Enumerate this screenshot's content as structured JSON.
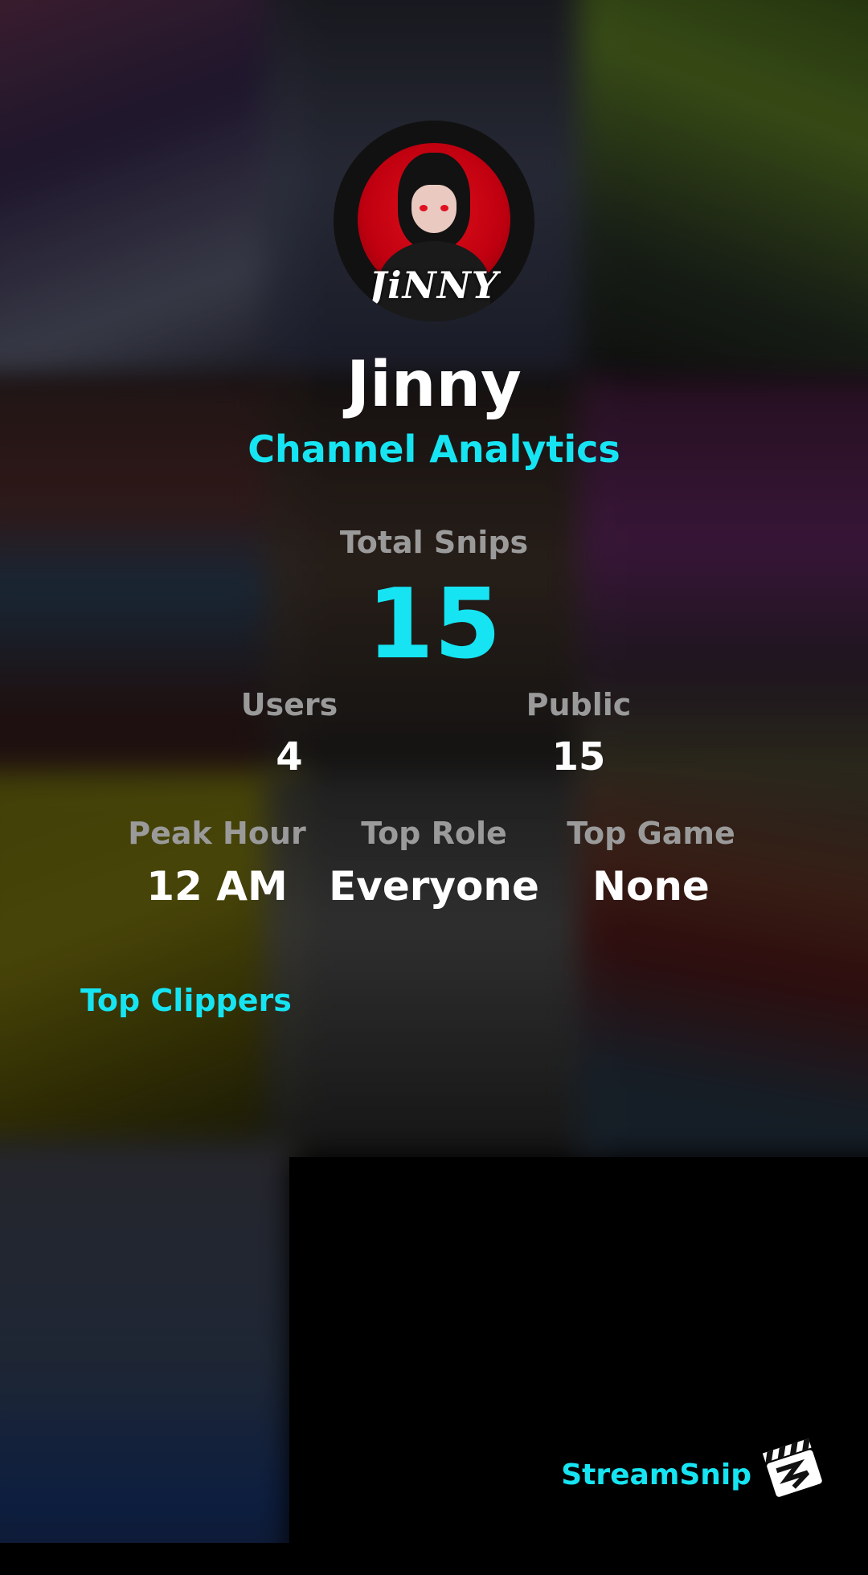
{
  "profile": {
    "avatar_text": "JiNNY",
    "name": "Jinny",
    "subtitle": "Channel Analytics"
  },
  "stats": {
    "total_snips_label": "Total Snips",
    "total_snips_value": "15",
    "users_label": "Users",
    "users_value": "4",
    "public_label": "Public",
    "public_value": "15",
    "peak_hour_label": "Peak Hour",
    "peak_hour_value": "12 AM",
    "top_role_label": "Top Role",
    "top_role_value": "Everyone",
    "top_game_label": "Top Game",
    "top_game_value": "None"
  },
  "sections": {
    "top_clippers_label": "Top Clippers"
  },
  "branding": {
    "name": "StreamSnip",
    "logo_icon": "clapperboard-icon"
  },
  "colors": {
    "accent": "#16e4f2",
    "label": "#9a9a9a",
    "text": "#ffffff",
    "avatar_red": "#d00010"
  }
}
